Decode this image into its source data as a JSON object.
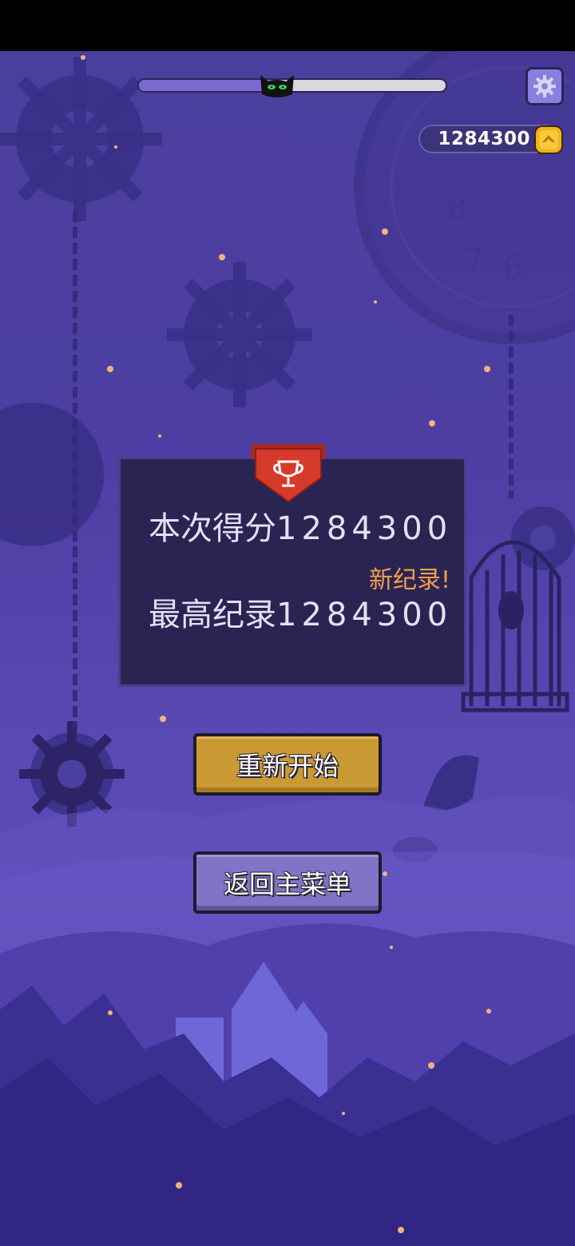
{
  "hud": {
    "progress": 0.45,
    "coins": "1284300",
    "settings_icon": "gear-icon",
    "coin_icon": "coin-icon",
    "marker_icon": "black-cat-icon"
  },
  "result": {
    "current_label": "本次得分",
    "current_score": "1284300",
    "best_label": "最高纪录",
    "best_score": "1284300",
    "new_record_label": "新纪录!",
    "badge_icon": "trophy-icon"
  },
  "buttons": {
    "restart_label": "重新开始",
    "main_menu_label": "返回主菜单"
  },
  "colors": {
    "background": "#4d3fa3",
    "panel": "#2a2452",
    "restart_button": "#c99a34",
    "menu_button": "#7f74c6",
    "new_record_text": "#f0a04a",
    "ribbon": "#d63a2a"
  }
}
